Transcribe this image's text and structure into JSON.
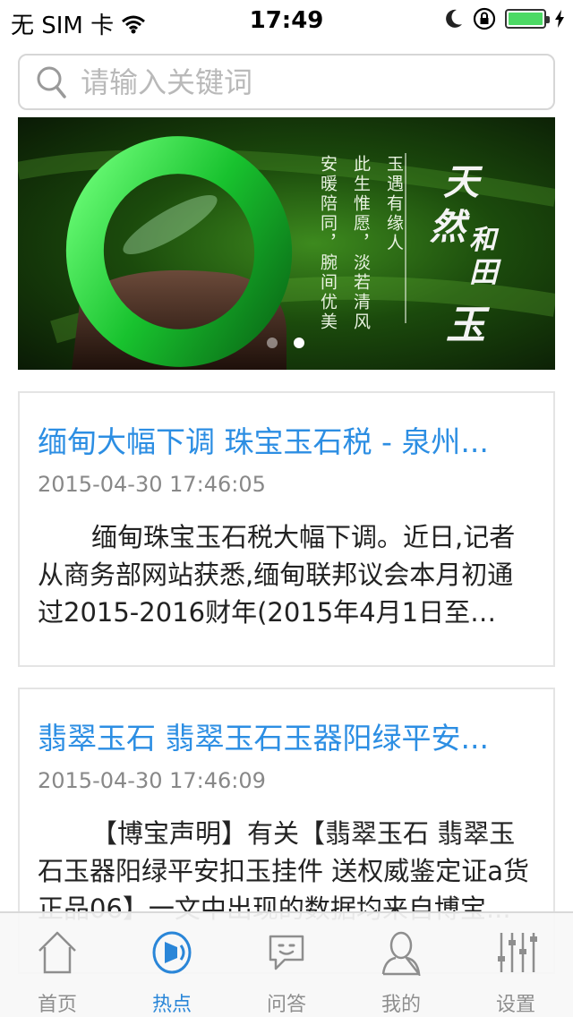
{
  "status_bar": {
    "carrier": "无 SIM 卡",
    "time": "17:49",
    "icons": [
      "wifi-icon",
      "moon-icon",
      "rotation-lock-icon",
      "battery-icon"
    ]
  },
  "search": {
    "placeholder": "请输入关键词"
  },
  "banner": {
    "title_chars": [
      "天",
      "然",
      "和",
      "田",
      "玉"
    ],
    "lines": [
      "玉遇有缘人",
      "此生惟愿，淡若清风",
      "安暖陪同，腕间优美"
    ],
    "page_count": 2,
    "active_page": 2
  },
  "articles": [
    {
      "title": "缅甸大幅下调 珠宝玉石税 - 泉州...",
      "date": "2015-04-30 17:46:05",
      "summary": "缅甸珠宝玉石税大幅下调。近日,记者从商务部网站获悉,缅甸联邦议会本月初通过2015-2016财年(2015年4月1日至201..."
    },
    {
      "title": "翡翠玉石 翡翠玉石玉器阳绿平安...",
      "date": "2015-04-30 17:46:09",
      "summary": "【博宝声明】有关【翡翠玉石 翡翠玉石玉器阳绿平安扣玉挂件 送权威鉴定证a货正品06】一文中出现的数据均来自博宝..."
    }
  ],
  "tab_bar": {
    "active": "热点",
    "tabs": [
      {
        "label": "首页",
        "icon": "home-icon"
      },
      {
        "label": "热点",
        "icon": "hot-speaker-icon"
      },
      {
        "label": "问答",
        "icon": "chat-bubble-icon"
      },
      {
        "label": "我的",
        "icon": "user-icon"
      },
      {
        "label": "设置",
        "icon": "sliders-icon"
      }
    ]
  },
  "colors": {
    "accent": "#2a86d8",
    "title_blue": "#2c8ee3",
    "battery_green": "#4cd964"
  }
}
